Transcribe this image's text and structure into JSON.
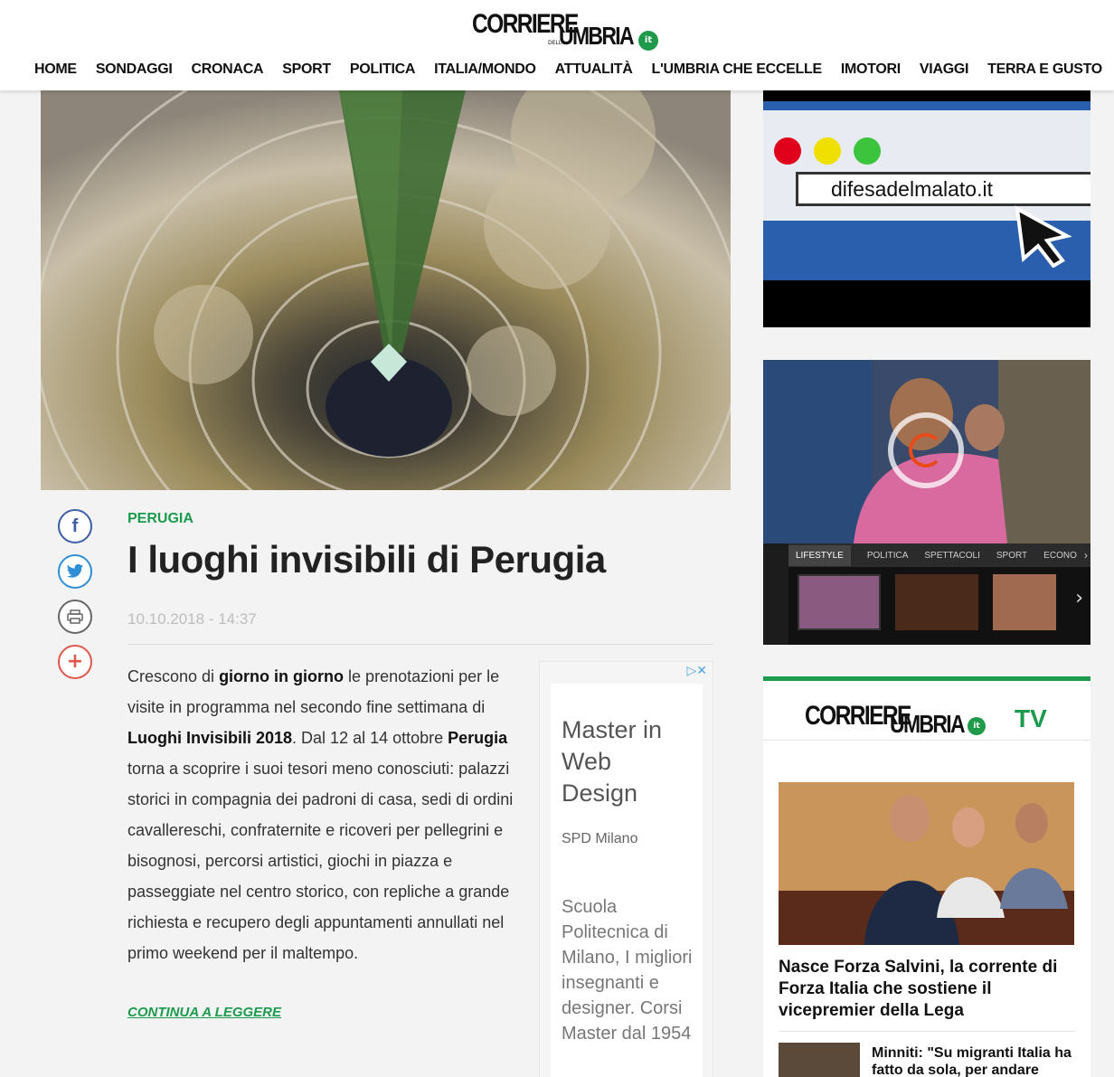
{
  "header": {
    "logo": {
      "corriere": "CORRIERE",
      "delle": "DELL'",
      "umbria": "UMBRIA",
      "it": "it"
    },
    "nav": [
      "HOME",
      "SONDAGGI",
      "CRONACA",
      "SPORT",
      "POLITICA",
      "ITALIA/MONDO",
      "ATTUALITÀ",
      "L'UMBRIA CHE ECCELLE",
      "IMOTORI",
      "VIAGGI",
      "TERRA E GUSTO"
    ]
  },
  "article": {
    "category": "PERUGIA",
    "title": "I luoghi invisibili di Perugia",
    "date": "10.10.2018 - 14:37",
    "read_more": "CONTINUA A LEGGERE"
  },
  "ad": {
    "title": "Master in Web Design",
    "source": "SPD Milano",
    "body": "Scuola Politecnica di Milano, I migliori insegnanti e designer. Corsi Master dal 1954"
  },
  "sidebar": {
    "banner_url": "difesadelmalato.it",
    "video_tabs": [
      "LIFESTYLE",
      "POLITICA",
      "SPETTACOLI",
      "SPORT",
      "ECONO"
    ],
    "tv": {
      "label": "TV",
      "headline": "Nasce Forza Salvini, la corrente di Forza Italia che sostiene il vicepremier della Lega",
      "second_headline": "Minniti: \"Su migranti Italia ha fatto da sola, per andare"
    }
  },
  "colors": {
    "accent": "#1c9a4d",
    "facebook": "#3c5fa6",
    "twitter": "#2e8fd6",
    "plus": "#e2574c"
  }
}
